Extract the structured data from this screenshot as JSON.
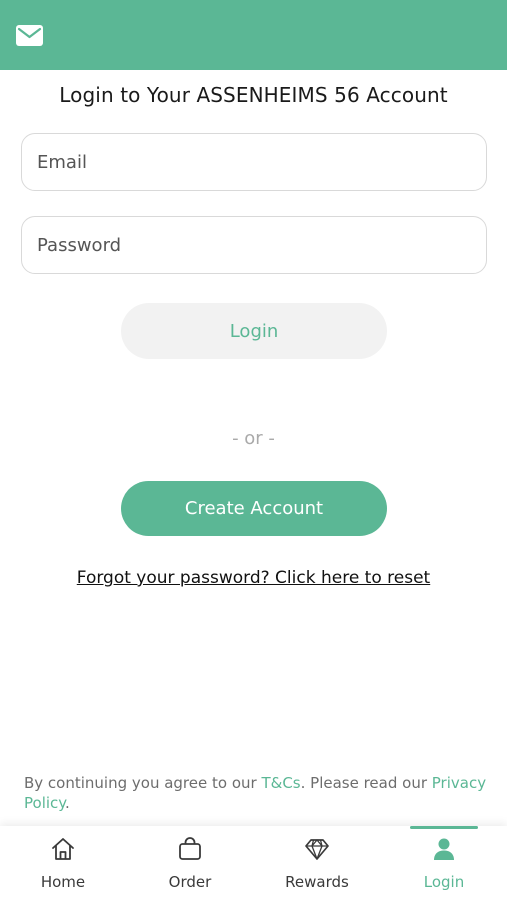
{
  "header": {
    "icon": "mail-icon",
    "color": "#5bb795"
  },
  "title": "Login to Your ASSENHEIMS 56 Account",
  "form": {
    "email_placeholder": "Email",
    "password_placeholder": "Password",
    "login_label": "Login",
    "or_label": "- or -",
    "create_label": "Create Account",
    "forgot_label": "Forgot your password? Click here to reset"
  },
  "terms": {
    "prefix": "By continuing you agree to our ",
    "tcs_link": "T&Cs",
    "middle": ". Please read our ",
    "privacy_link": "Privacy Policy",
    "suffix": "."
  },
  "tabs": [
    {
      "label": "Home",
      "icon": "home-icon"
    },
    {
      "label": "Order",
      "icon": "bag-icon"
    },
    {
      "label": "Rewards",
      "icon": "diamond-icon"
    },
    {
      "label": "Login",
      "icon": "user-icon",
      "active": true
    }
  ],
  "colors": {
    "accent": "#5bb795",
    "button_muted": "#f2f2f2"
  }
}
